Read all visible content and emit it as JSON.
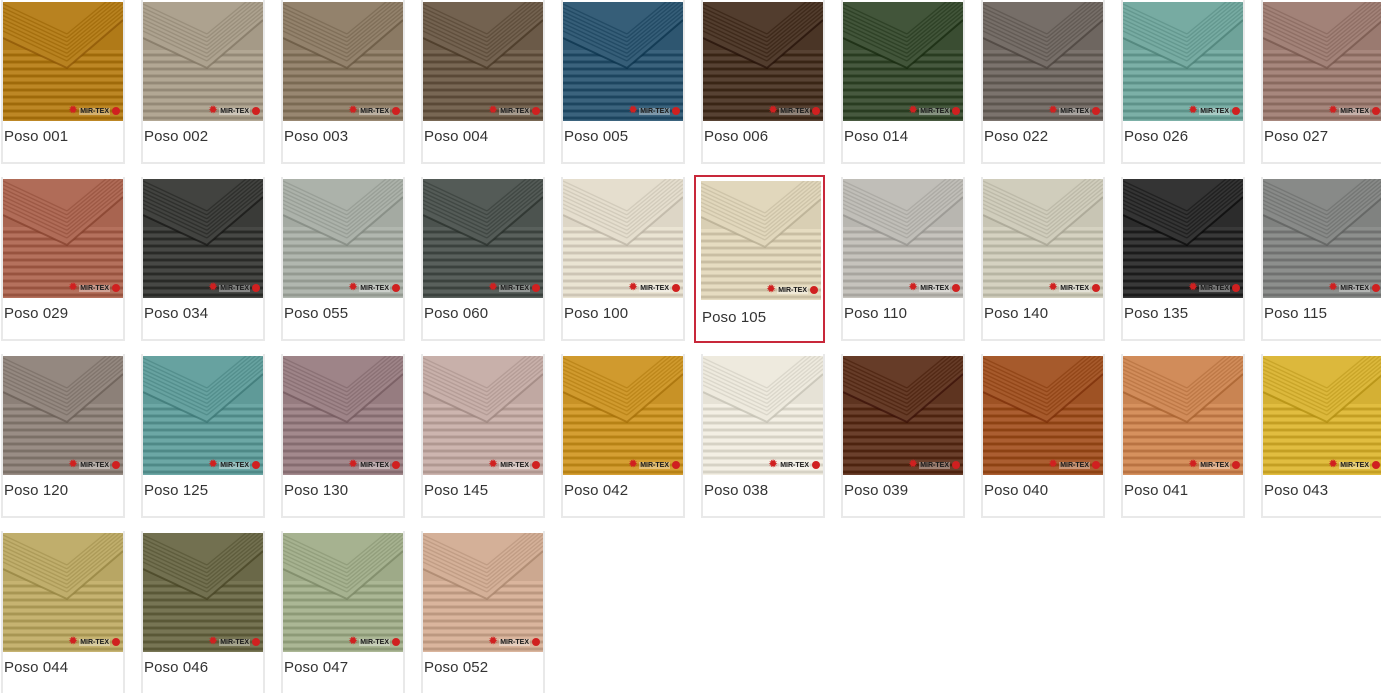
{
  "swatches": [
    {
      "name": "Poso 001",
      "color": "#b07a18"
    },
    {
      "name": "Poso 002",
      "color": "#a59a87"
    },
    {
      "name": "Poso 003",
      "color": "#8b7a64"
    },
    {
      "name": "Poso 004",
      "color": "#6b5a48"
    },
    {
      "name": "Poso 005",
      "color": "#2e5670"
    },
    {
      "name": "Poso 006",
      "color": "#4a3526"
    },
    {
      "name": "Poso 014",
      "color": "#3a4d32"
    },
    {
      "name": "Poso 022",
      "color": "#6e6660"
    },
    {
      "name": "Poso 026",
      "color": "#6fa39a"
    },
    {
      "name": "Poso 027",
      "color": "#9a7a70"
    },
    {
      "name": "Poso 029",
      "color": "#a86450"
    },
    {
      "name": "Poso 034",
      "color": "#3a3b38"
    },
    {
      "name": "Poso 055",
      "color": "#a4aaa2"
    },
    {
      "name": "Poso 060",
      "color": "#4c534f"
    },
    {
      "name": "Poso 100",
      "color": "#ddd6c6"
    },
    {
      "name": "Poso 105",
      "color": "#d9cfb4"
    },
    {
      "name": "Poso 110",
      "color": "#b8b6b0"
    },
    {
      "name": "Poso 140",
      "color": "#c8c5b4"
    },
    {
      "name": "Poso 135",
      "color": "#2c2c2c"
    },
    {
      "name": "Poso 115",
      "color": "#808280"
    },
    {
      "name": "Poso 120",
      "color": "#8c8078"
    },
    {
      "name": "Poso 125",
      "color": "#5f9a98"
    },
    {
      "name": "Poso 130",
      "color": "#967c80"
    },
    {
      "name": "Poso 145",
      "color": "#c0a8a2"
    },
    {
      "name": "Poso 042",
      "color": "#c89226"
    },
    {
      "name": "Poso 038",
      "color": "#e6e2d6"
    },
    {
      "name": "Poso 039",
      "color": "#5e3420"
    },
    {
      "name": "Poso 040",
      "color": "#9e5224"
    },
    {
      "name": "Poso 041",
      "color": "#c98452"
    },
    {
      "name": "Poso 043",
      "color": "#d4b034"
    },
    {
      "name": "Poso 044",
      "color": "#b8a664"
    },
    {
      "name": "Poso 046",
      "color": "#6a6848"
    },
    {
      "name": "Poso 047",
      "color": "#9eaa88"
    },
    {
      "name": "Poso 052",
      "color": "#cca890"
    }
  ],
  "selected_index": 15,
  "logo_text": "MIR-TEX"
}
